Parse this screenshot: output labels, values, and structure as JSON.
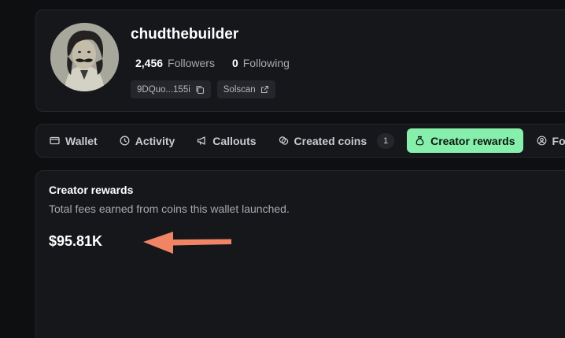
{
  "profile": {
    "username": "chudthebuilder",
    "followers_count": "2,456",
    "followers_label": "Followers",
    "following_count": "0",
    "following_label": "Following",
    "wallet_address": "9DQuo...155i",
    "solscan_label": "Solscan"
  },
  "tabs": [
    {
      "label": "Wallet",
      "icon": "wallet-icon"
    },
    {
      "label": "Activity",
      "icon": "clock-icon"
    },
    {
      "label": "Callouts",
      "icon": "megaphone-icon"
    },
    {
      "label": "Created coins",
      "icon": "coins-icon",
      "badge": "1"
    },
    {
      "label": "Creator rewards",
      "icon": "money-bag-icon",
      "active": true
    },
    {
      "label": "Fo",
      "icon": "user-circle-icon"
    }
  ],
  "rewards": {
    "title": "Creator rewards",
    "description": "Total fees earned from coins this wallet launched.",
    "amount": "$95.81K"
  },
  "colors": {
    "background": "#0e0f11",
    "card": "#16171b",
    "accent": "#86efac",
    "annotation_arrow": "#f28466"
  }
}
